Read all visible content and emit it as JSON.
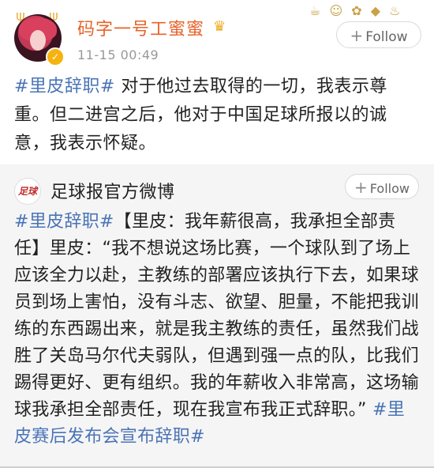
{
  "post": {
    "username": "码字一号工蜜蜜",
    "timestamp": "11-15 00:49",
    "follow_label": "Follow",
    "hashtag": "#里皮辞职#",
    "text": " 对于他过去取得的一切，我表示尊重。但二进宫之后，他对于中国足球所报以的诚意，我表示怀疑。"
  },
  "retweet": {
    "username": "足球报官方微博",
    "avatar_text": "足球",
    "follow_label": "Follow",
    "hashtag_start": "#里皮辞职#",
    "text": "【里皮：我年薪很高，我承担全部责任】里皮：“我不想说这场比赛，一个球队到了场上应该全力以赴，主教练的部署应该执行下去，如果球员到场上害怕，没有斗志、欲望、胆量，不能把我训练的东西踢出来，就是我主教练的责任，虽然我们战胜了关岛马尔代夫弱队，但遇到强一点的队，比我们踢得更好、更有组织。我的年薪收入非常高，这场输球我承担全部责任，现在我宣布我正式辞职。” ",
    "hashtag_end": "#里皮赛后发布会宣布辞职#"
  },
  "icons": {
    "follow": "plus-icon",
    "verified": "verified-badge-icon",
    "crown": "crown-icon"
  },
  "colors": {
    "username": "#e8632a",
    "hashtag": "#4a74b6",
    "timestamp": "#999999",
    "retweet_bg": "#f5f5f5"
  }
}
